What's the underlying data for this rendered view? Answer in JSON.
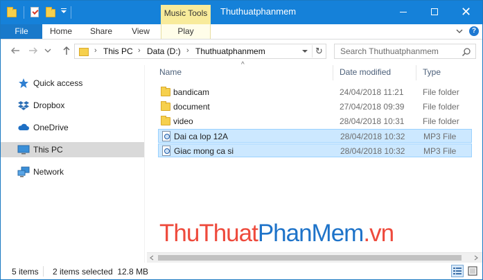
{
  "window": {
    "title": "Thuthuatphanmem",
    "context_tab": "Music Tools"
  },
  "ribbon": {
    "file": "File",
    "tabs": [
      "Home",
      "Share",
      "View",
      "Play"
    ]
  },
  "address": {
    "crumbs": [
      "This PC",
      "Data (D:)",
      "Thuthuatphanmem"
    ],
    "search_placeholder": "Search Thuthuatphanmem"
  },
  "navpane": {
    "items": [
      {
        "label": "Quick access",
        "icon": "star-icon"
      },
      {
        "label": "Dropbox",
        "icon": "dropbox-icon"
      },
      {
        "label": "OneDrive",
        "icon": "cloud-icon"
      },
      {
        "label": "This PC",
        "icon": "computer-icon",
        "selected": true
      },
      {
        "label": "Network",
        "icon": "network-icon"
      }
    ]
  },
  "columns": {
    "name": "Name",
    "date": "Date modified",
    "type": "Type"
  },
  "files": [
    {
      "name": "bandicam",
      "date": "24/04/2018 11:21",
      "type": "File folder",
      "kind": "folder",
      "selected": false
    },
    {
      "name": "document",
      "date": "27/04/2018 09:39",
      "type": "File folder",
      "kind": "folder",
      "selected": false
    },
    {
      "name": "video",
      "date": "28/04/2018 10:31",
      "type": "File folder",
      "kind": "folder",
      "selected": false
    },
    {
      "name": "Dai ca lop 12A",
      "date": "28/04/2018 10:32",
      "type": "MP3 File",
      "kind": "mp3",
      "selected": true
    },
    {
      "name": "Giac mong ca si",
      "date": "28/04/2018 10:32",
      "type": "MP3 File",
      "kind": "mp3",
      "selected": true
    }
  ],
  "watermark": {
    "part1": "ThuThuat",
    "part2": "PhanMem",
    "part3": ".vn"
  },
  "status": {
    "item_count": "5 items",
    "selection": "2 items selected  12.8 MB"
  },
  "colors": {
    "titlebar": "#1581d9",
    "context_tab": "#f8eb9b",
    "selection": "#cce8ff"
  }
}
